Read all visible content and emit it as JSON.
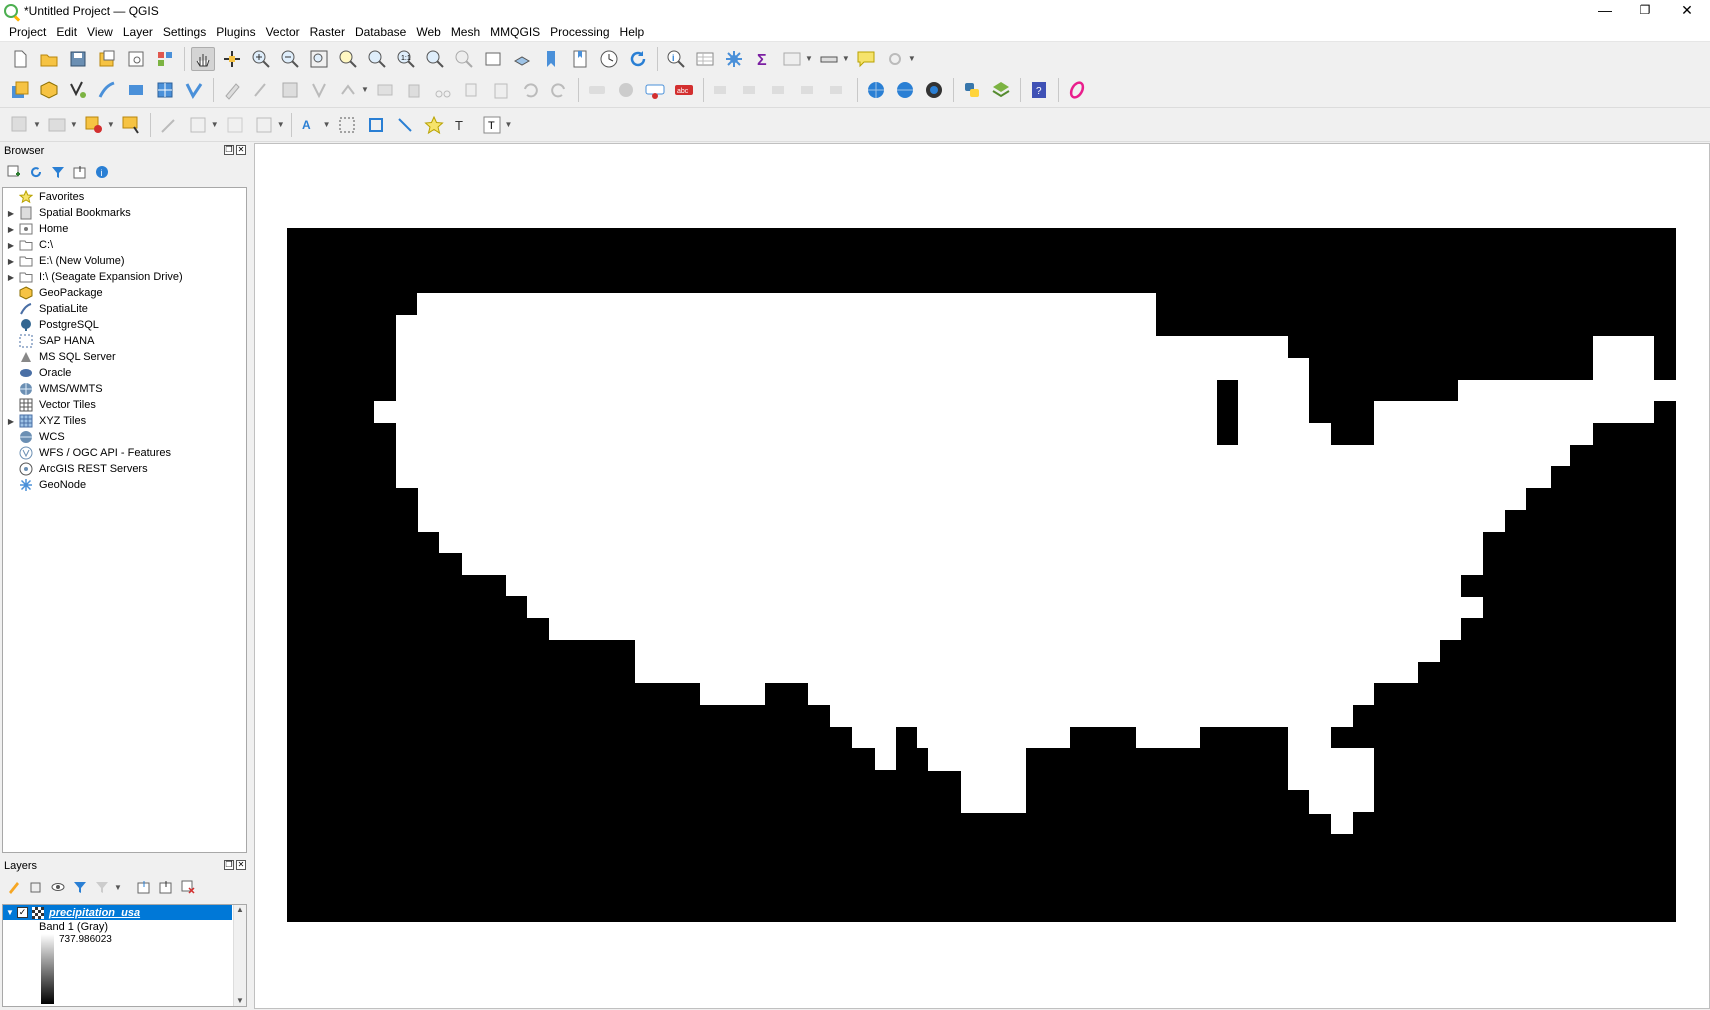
{
  "window": {
    "title": "*Untitled Project — QGIS",
    "minimize": "—",
    "maximize": "❐",
    "close": "✕"
  },
  "menu": [
    "Project",
    "Edit",
    "View",
    "Layer",
    "Settings",
    "Plugins",
    "Vector",
    "Raster",
    "Database",
    "Web",
    "Mesh",
    "MMQGIS",
    "Processing",
    "Help"
  ],
  "browser": {
    "title": "Browser",
    "items": [
      {
        "label": "Favorites",
        "icon": "star-icon",
        "expandable": false
      },
      {
        "label": "Spatial Bookmarks",
        "icon": "bookmarks-icon",
        "expandable": true
      },
      {
        "label": "Home",
        "icon": "home-folder-icon",
        "expandable": true
      },
      {
        "label": "C:\\",
        "icon": "folder-icon",
        "expandable": true
      },
      {
        "label": "E:\\ (New Volume)",
        "icon": "folder-icon",
        "expandable": true
      },
      {
        "label": "I:\\ (Seagate Expansion Drive)",
        "icon": "folder-icon",
        "expandable": true
      },
      {
        "label": "GeoPackage",
        "icon": "geopackage-icon",
        "expandable": false
      },
      {
        "label": "SpatiaLite",
        "icon": "spatialite-icon",
        "expandable": false
      },
      {
        "label": "PostgreSQL",
        "icon": "postgresql-icon",
        "expandable": false
      },
      {
        "label": "SAP HANA",
        "icon": "sap-hana-icon",
        "expandable": false
      },
      {
        "label": "MS SQL Server",
        "icon": "mssql-icon",
        "expandable": false
      },
      {
        "label": "Oracle",
        "icon": "oracle-icon",
        "expandable": false
      },
      {
        "label": "WMS/WMTS",
        "icon": "wms-icon",
        "expandable": false
      },
      {
        "label": "Vector Tiles",
        "icon": "vector-tiles-icon",
        "expandable": false
      },
      {
        "label": "XYZ Tiles",
        "icon": "xyz-tiles-icon",
        "expandable": true
      },
      {
        "label": "WCS",
        "icon": "wcs-icon",
        "expandable": false
      },
      {
        "label": "WFS / OGC API - Features",
        "icon": "wfs-icon",
        "expandable": false
      },
      {
        "label": "ArcGIS REST Servers",
        "icon": "arcgis-icon",
        "expandable": false
      },
      {
        "label": "GeoNode",
        "icon": "geonode-icon",
        "expandable": false
      }
    ]
  },
  "layers": {
    "title": "Layers",
    "layer_name": "precipitation_usa",
    "checked": true,
    "band_label": "Band 1 (Gray)",
    "max_value": "737.986023"
  },
  "map": {
    "background_color": "#000000",
    "land_color": "#ffffff"
  }
}
